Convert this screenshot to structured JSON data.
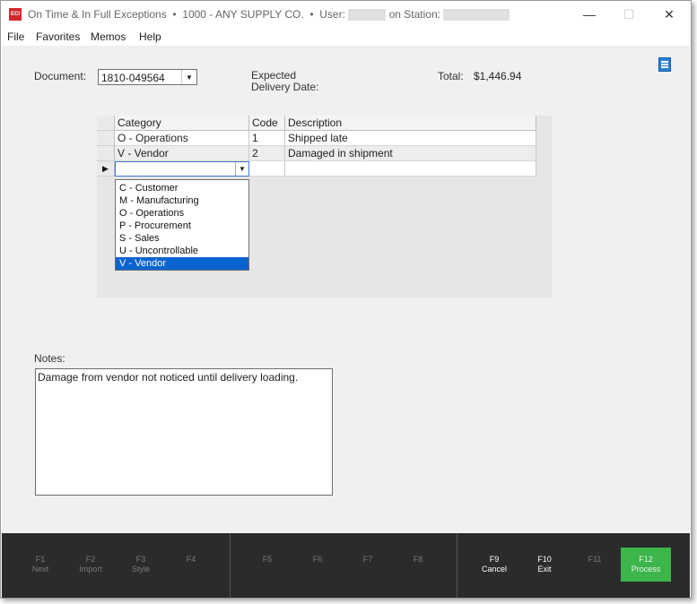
{
  "window": {
    "app_icon": "ECI",
    "title": "On Time & In Full Exceptions",
    "company": "1000 - ANY SUPPLY CO.",
    "user_label": "User:",
    "station_label": "on Station:",
    "minimize_icon": "—",
    "maximize_icon": "☐",
    "close_icon": "✕"
  },
  "menu": [
    "File",
    "Favorites",
    "Memos",
    "Help"
  ],
  "form": {
    "document_label": "Document:",
    "document_value": "1810-049564",
    "expected_label_1": "Expected",
    "expected_label_2": "Delivery Date:",
    "total_label": "Total:",
    "total_value": "$1,446.94"
  },
  "grid": {
    "headers": [
      "Category",
      "Code",
      "Description"
    ],
    "rows": [
      {
        "category": "O - Operations",
        "code": "1",
        "description": "Shipped late"
      },
      {
        "category": "V - Vendor",
        "code": "2",
        "description": "Damaged in shipment"
      }
    ]
  },
  "dropdown": {
    "options": [
      "C - Customer",
      "M - Manufacturing",
      "O - Operations",
      "P - Procurement",
      "S - Sales",
      "U - Uncontrollable",
      "V - Vendor"
    ],
    "selected_index": 6
  },
  "notes": {
    "label": "Notes:",
    "text": "Damage from vendor not noticed until delivery loading."
  },
  "function_keys": [
    {
      "key": "F1",
      "label": "Next",
      "enabled": false
    },
    {
      "key": "F2",
      "label": "Import",
      "enabled": false
    },
    {
      "key": "F3",
      "label": "Style",
      "enabled": false
    },
    {
      "key": "F4",
      "label": "",
      "enabled": false
    },
    {
      "key": "F5",
      "label": "",
      "enabled": false
    },
    {
      "key": "F6",
      "label": "",
      "enabled": false
    },
    {
      "key": "F7",
      "label": "",
      "enabled": false
    },
    {
      "key": "F8",
      "label": "",
      "enabled": false
    },
    {
      "key": "F9",
      "label": "Cancel",
      "enabled": true
    },
    {
      "key": "F10",
      "label": "Exit",
      "enabled": true
    },
    {
      "key": "F11",
      "label": "",
      "enabled": false
    },
    {
      "key": "F12",
      "label": "Process",
      "enabled": true
    }
  ],
  "colors": {
    "process_button": "#3cb54a",
    "selection": "#0a64d0",
    "menu_icon": "#2b7fd8"
  }
}
